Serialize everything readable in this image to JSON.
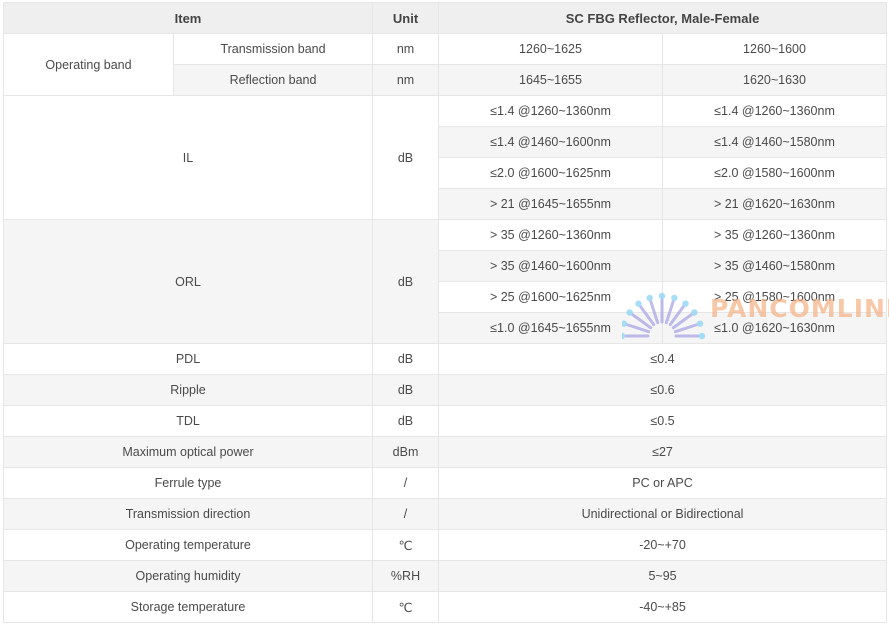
{
  "header": {
    "item": "Item",
    "unit": "Unit",
    "product": "SC FBG Reflector, Male-Female"
  },
  "operating_band": {
    "label": "Operating band",
    "transmission": {
      "label": "Transmission band",
      "unit": "nm",
      "a": "1260~1625",
      "b": "1260~1600"
    },
    "reflection": {
      "label": "Reflection band",
      "unit": "nm",
      "a": "1645~1655",
      "b": "1620~1630"
    }
  },
  "il": {
    "label": "IL",
    "unit": "dB",
    "rows": [
      {
        "a": "≤1.4 @1260~1360nm",
        "b": "≤1.4 @1260~1360nm"
      },
      {
        "a": "≤1.4 @1460~1600nm",
        "b": "≤1.4 @1460~1580nm"
      },
      {
        "a": "≤2.0 @1600~1625nm",
        "b": "≤2.0 @1580~1600nm"
      },
      {
        "a": "> 21 @1645~1655nm",
        "b": "> 21 @1620~1630nm"
      }
    ]
  },
  "orl": {
    "label": "ORL",
    "unit": "dB",
    "rows": [
      {
        "a": "> 35 @1260~1360nm",
        "b": "> 35 @1260~1360nm"
      },
      {
        "a": "> 35 @1460~1600nm",
        "b": "> 35 @1460~1580nm"
      },
      {
        "a": "> 25 @1600~1625nm",
        "b": "> 25 @1580~1600nm"
      },
      {
        "a": "≤1.0 @1645~1655nm",
        "b": "≤1.0 @1620~1630nm"
      }
    ]
  },
  "simple_rows": [
    {
      "label": "PDL",
      "unit": "dB",
      "value": "≤0.4"
    },
    {
      "label": "Ripple",
      "unit": "dB",
      "value": "≤0.6"
    },
    {
      "label": "TDL",
      "unit": "dB",
      "value": "≤0.5"
    },
    {
      "label": "Maximum optical power",
      "unit": "dBm",
      "value": "≤27"
    },
    {
      "label": "Ferrule type",
      "unit": "/",
      "value": "PC or APC"
    },
    {
      "label": "Transmission direction",
      "unit": "/",
      "value": "Unidirectional or Bidirectional"
    },
    {
      "label": "Operating temperature",
      "unit": "℃",
      "value": "-20~+70"
    },
    {
      "label": "Operating humidity",
      "unit": "%RH",
      "value": "5~95"
    },
    {
      "label": "Storage temperature",
      "unit": "℃",
      "value": "-40~+85"
    }
  ],
  "watermark": {
    "text": "PANCOMLINK",
    "ray_color": "#a9a6e6",
    "dot_color": "#8fd6f2",
    "text_color": "#f4b283"
  }
}
